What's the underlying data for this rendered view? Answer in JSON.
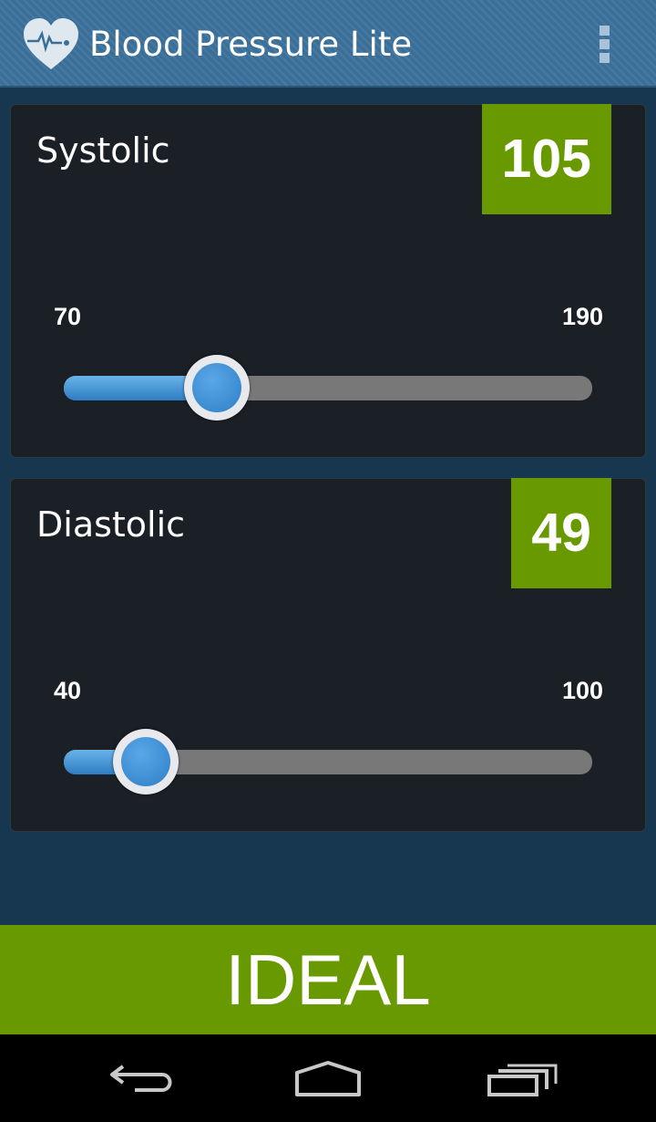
{
  "app": {
    "title": "Blood Pressure Lite"
  },
  "systolic": {
    "label": "Systolic",
    "value": "105",
    "min_label": "70",
    "max_label": "190",
    "slider_fraction": 0.29
  },
  "diastolic": {
    "label": "Diastolic",
    "value": "49",
    "min_label": "40",
    "max_label": "100",
    "slider_fraction": 0.155
  },
  "result": {
    "label": "IDEAL"
  },
  "colors": {
    "accent_green": "#689a00",
    "action_bar": "#3a6f99",
    "background": "#173650",
    "card": "#1b1f26",
    "slider_fill": "#3f8fd4"
  },
  "icons": {
    "app": "heart-pulse-icon",
    "overflow": "overflow-menu-icon",
    "back": "back-icon",
    "home": "home-icon",
    "recents": "recents-icon"
  }
}
